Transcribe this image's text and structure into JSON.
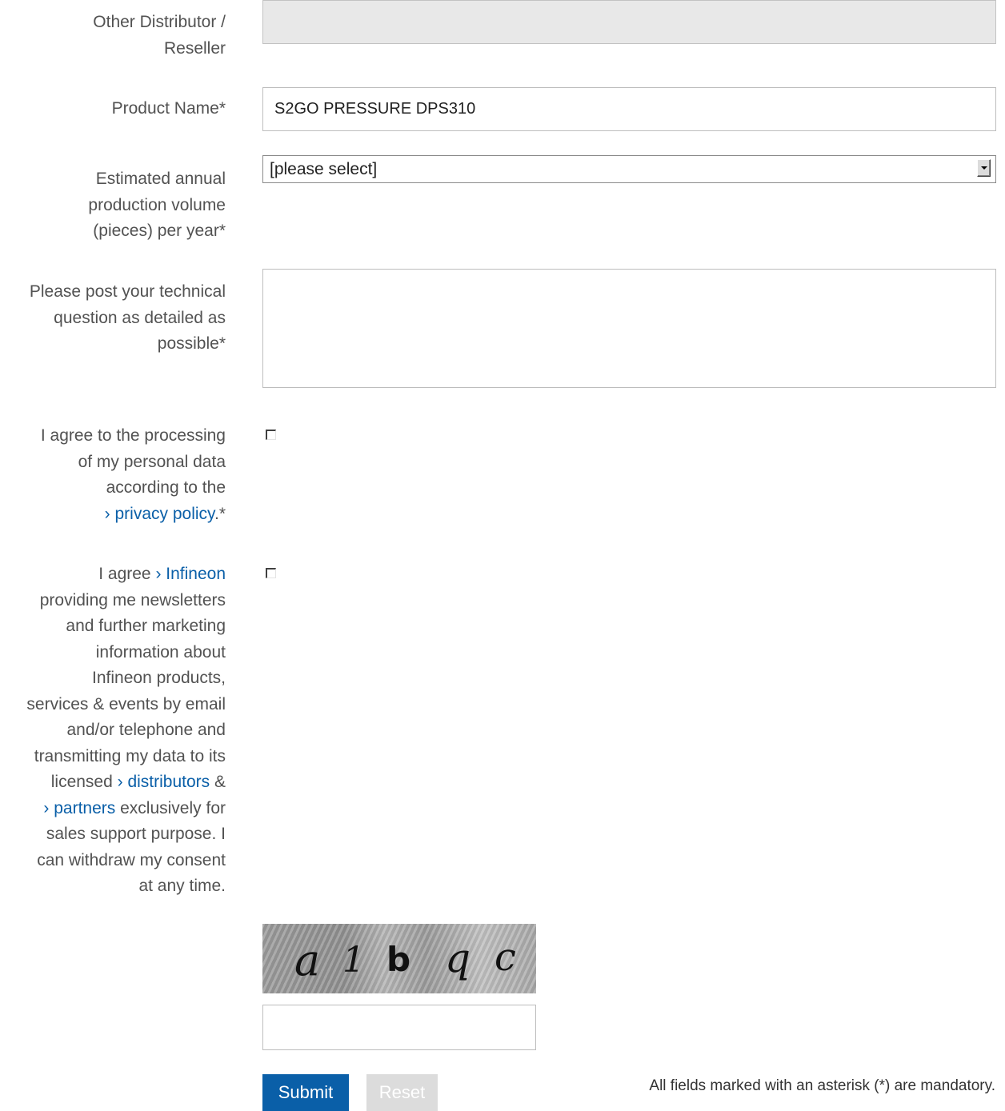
{
  "fields": {
    "other_distributor": {
      "label_line1": "Other Distributor /",
      "label_line2": "Reseller",
      "value": ""
    },
    "product_name": {
      "label": "Product Name*",
      "value": "S2GO PRESSURE DPS310"
    },
    "production_volume": {
      "label_line1": "Estimated annual",
      "label_line2": "production volume",
      "label_line3": "(pieces) per year*",
      "selected": "[please select]"
    },
    "technical_question": {
      "label_line1": "Please post your technical",
      "label_line2": "question as detailed as",
      "label_line3": "possible*",
      "value": ""
    }
  },
  "consent_privacy": {
    "line1": "I agree to the processing",
    "line2": "of my personal data",
    "line3": "according to the",
    "link": "› privacy policy",
    "suffix": ".*",
    "checked": false
  },
  "consent_marketing": {
    "prefix": "I agree ",
    "link_infineon": "› Infineon",
    "line2": "providing me newsletters",
    "line3": "and further marketing",
    "line4": "information about",
    "line5": "Infineon products,",
    "line6": "services & events by email",
    "line7": "and/or telephone and",
    "line8": "transmitting my data to its",
    "line9_prefix": "licensed ",
    "link_distributors": "› distributors",
    "line9_suffix": " &",
    "link_partners": "› partners",
    "line10_suffix": " exclusively for",
    "line11": "sales support purpose. I",
    "line12": "can withdraw my consent",
    "line13": "at any time.",
    "checked": false
  },
  "captcha": {
    "chars": [
      "a",
      "1",
      "b",
      "q",
      "c"
    ],
    "input_value": ""
  },
  "buttons": {
    "submit": "Submit",
    "reset": "Reset"
  },
  "mandatory_note": "All fields marked with an asterisk (*) are mandatory."
}
